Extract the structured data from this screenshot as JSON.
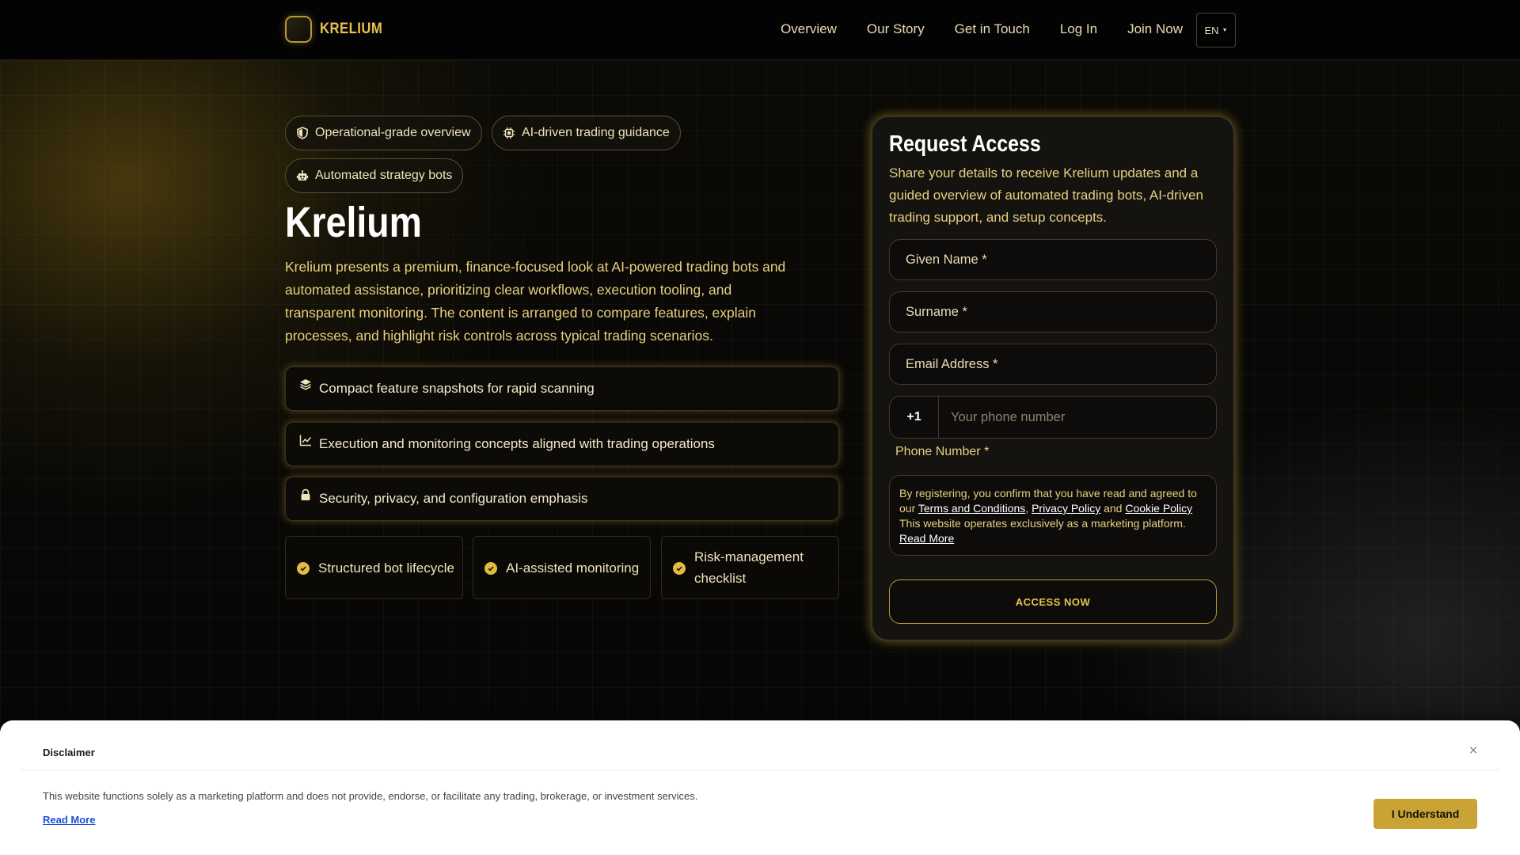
{
  "brand": {
    "name": "KRELIUM"
  },
  "nav": {
    "items": [
      {
        "label": "Overview"
      },
      {
        "label": "Our Story"
      },
      {
        "label": "Get in Touch"
      },
      {
        "label": "Log In"
      },
      {
        "label": "Join Now"
      }
    ],
    "language": "EN"
  },
  "hero": {
    "pills": [
      {
        "label": "Operational-grade overview",
        "icon": "shield-icon"
      },
      {
        "label": "AI-driven trading guidance",
        "icon": "chip-icon"
      },
      {
        "label": "Automated strategy bots",
        "icon": "robot-icon"
      }
    ],
    "title": "Krelium",
    "description": "Krelium presents a premium, finance-focused look at AI-powered trading bots and automated assistance, prioritizing clear workflows, execution tooling, and transparent monitoring. The content is arranged to compare features, explain processes, and highlight risk controls across typical trading scenarios.",
    "features": [
      {
        "label": "Compact feature snapshots for rapid scanning",
        "icon": "layers-icon"
      },
      {
        "label": "Execution and monitoring concepts aligned with trading operations",
        "icon": "chart-line-icon"
      },
      {
        "label": "Security, privacy, and configuration emphasis",
        "icon": "lock-icon"
      }
    ],
    "highlights": [
      {
        "label": "Structured bot lifecycle"
      },
      {
        "label": "AI-assisted monitoring"
      },
      {
        "label": "Risk-management checklist"
      }
    ]
  },
  "form": {
    "title": "Request Access",
    "subtitle": "Share your details to receive Krelium updates and a guided overview of automated trading bots, AI-driven trading support, and setup concepts.",
    "given_name_placeholder": "Given Name *",
    "surname_placeholder": "Surname *",
    "email_placeholder": "Email Address *",
    "phone_code": "+1",
    "phone_placeholder": "Your phone number",
    "phone_label": "Phone Number *",
    "consent": {
      "prefix": "By registering, you confirm that you have read and agreed to our ",
      "terms": "Terms and Conditions",
      "sep1": ", ",
      "privacy": "Privacy Policy",
      "and": " and ",
      "cookie": "Cookie Policy",
      "suffix": " This website operates exclusively as a marketing platform. ",
      "read_more": "Read More"
    },
    "submit_label": "ACCESS NOW"
  },
  "disclaimer": {
    "title": "Disclaimer",
    "text": "This website functions solely as a marketing platform and does not provide, endorse, or facilitate any trading, brokerage, or investment services.",
    "read_more": "Read More",
    "button": "I Understand",
    "close": "×"
  },
  "colors": {
    "accent": "#e8c34f",
    "background": "#050505",
    "button": "#c9a434"
  }
}
